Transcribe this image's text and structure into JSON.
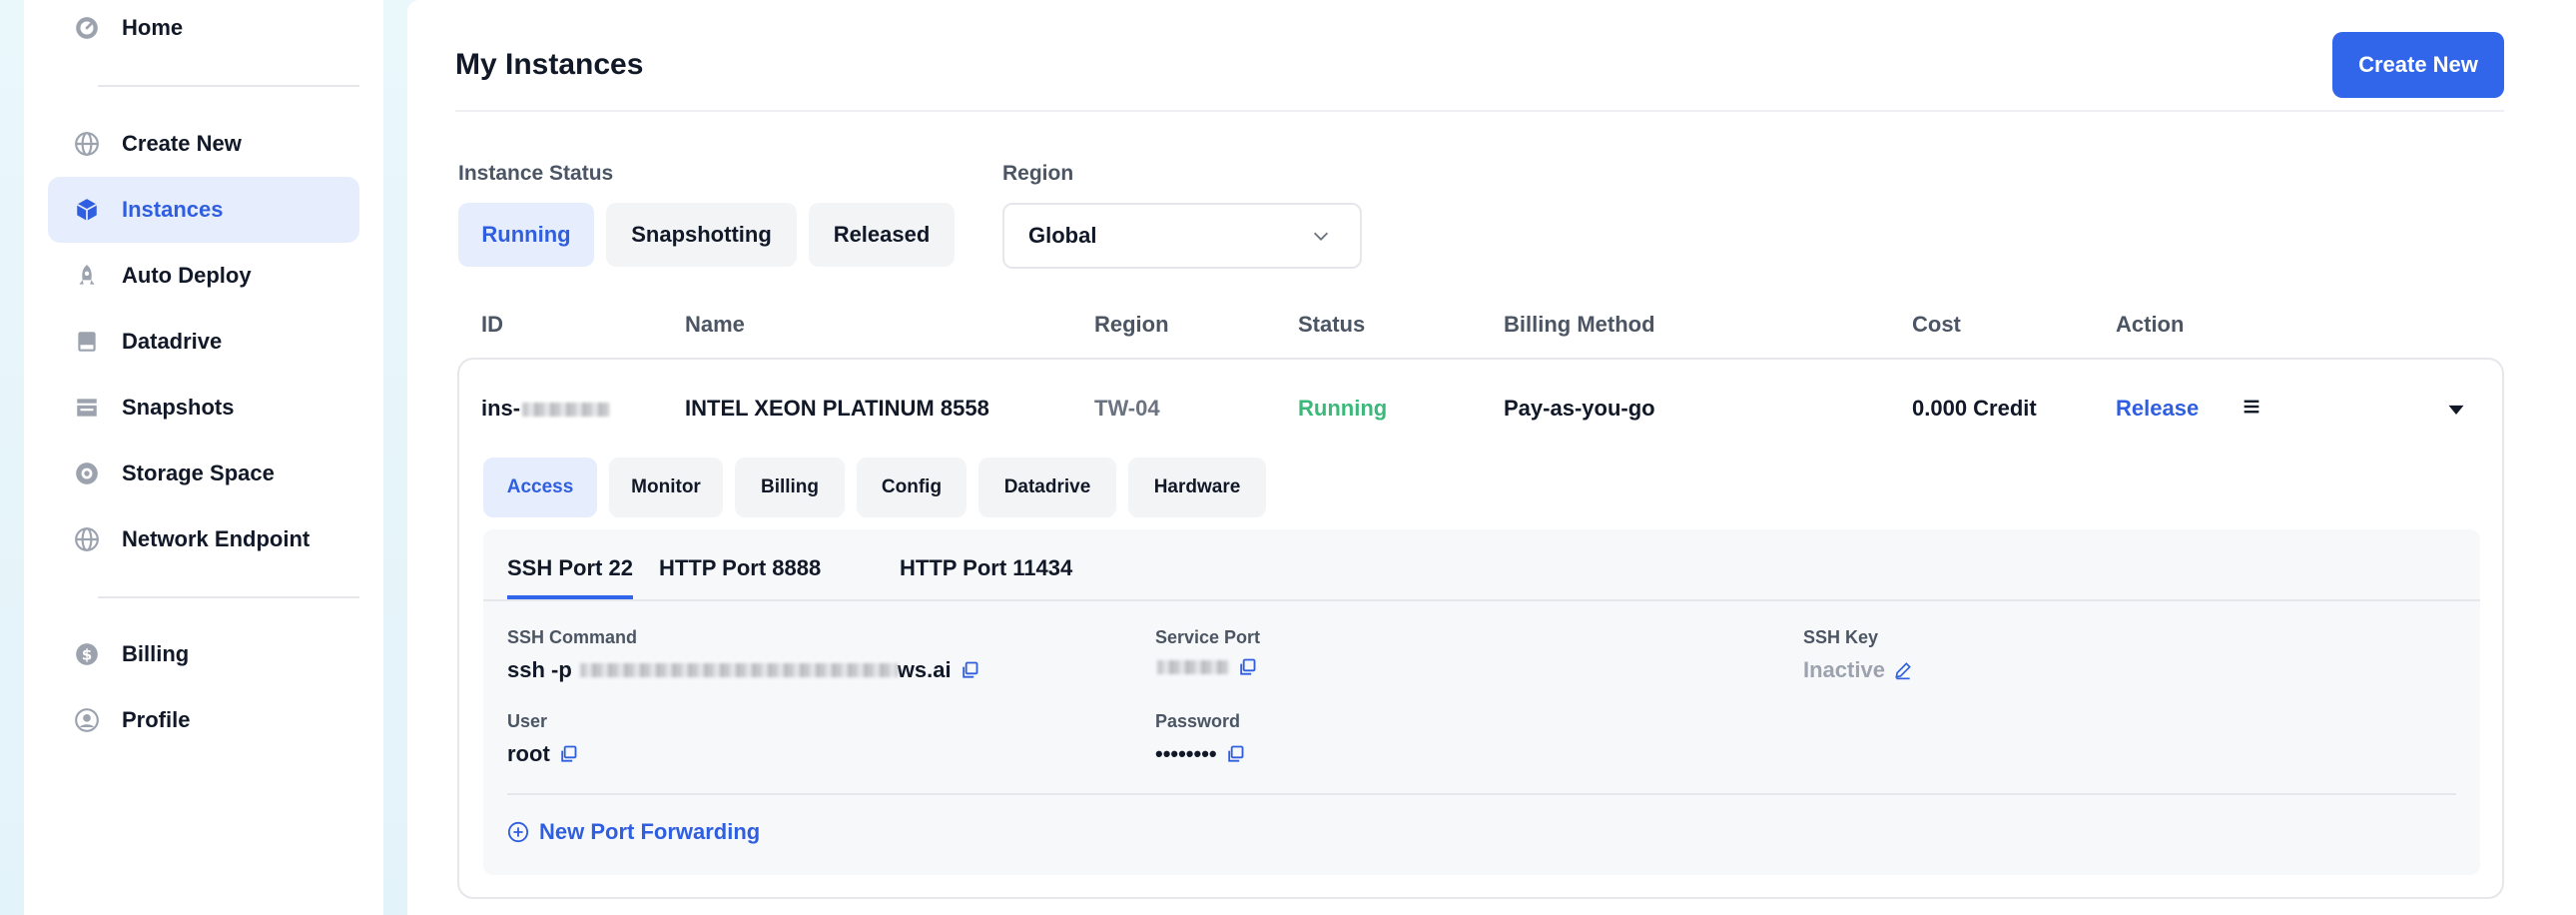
{
  "sidebar": {
    "items": [
      {
        "label": "Home",
        "icon": "dashboard-icon"
      },
      {
        "label": "Create New",
        "icon": "globe-icon"
      },
      {
        "label": "Instances",
        "icon": "cube-icon"
      },
      {
        "label": "Auto Deploy",
        "icon": "rocket-icon"
      },
      {
        "label": "Datadrive",
        "icon": "drive-icon"
      },
      {
        "label": "Snapshots",
        "icon": "snapshot-icon"
      },
      {
        "label": "Storage Space",
        "icon": "storage-icon"
      },
      {
        "label": "Network Endpoint",
        "icon": "globe-icon"
      },
      {
        "label": "Billing",
        "icon": "dollar-icon"
      },
      {
        "label": "Profile",
        "icon": "user-icon"
      }
    ],
    "active": "Instances"
  },
  "header": {
    "title": "My Instances",
    "create_label": "Create New"
  },
  "filters": {
    "status_label": "Instance Status",
    "status_options": [
      "Running",
      "Snapshotting",
      "Released"
    ],
    "status_selected": "Running",
    "region_label": "Region",
    "region_value": "Global"
  },
  "table": {
    "columns": [
      "ID",
      "Name",
      "Region",
      "Status",
      "Billing Method",
      "Cost",
      "Action"
    ],
    "row": {
      "id": "ins-",
      "name": "INTEL XEON PLATINUM 8558",
      "region": "TW-04",
      "status": "Running",
      "billing": "Pay-as-you-go",
      "cost": "0.000 Credit",
      "action": "Release"
    }
  },
  "detail": {
    "tabs": [
      "Access",
      "Monitor",
      "Billing",
      "Config",
      "Datadrive",
      "Hardware"
    ],
    "active_tab": "Access",
    "port_tabs": [
      "SSH Port 22",
      "HTTP Port 8888",
      "HTTP Port 11434"
    ],
    "fields": {
      "ssh_command_label": "SSH Command",
      "ssh_command_prefix": "ssh -p",
      "ssh_command_suffix": "ws.ai",
      "service_port_label": "Service Port",
      "ssh_key_label": "SSH Key",
      "ssh_key_value": "Inactive",
      "user_label": "User",
      "user_value": "root",
      "password_label": "Password",
      "password_value": "••••••••"
    },
    "new_port_forwarding": "New Port Forwarding"
  },
  "colors": {
    "accent": "#3166ea",
    "active_bg": "#e6edfc",
    "running": "#3bb87a",
    "muted": "#9ca3af"
  }
}
